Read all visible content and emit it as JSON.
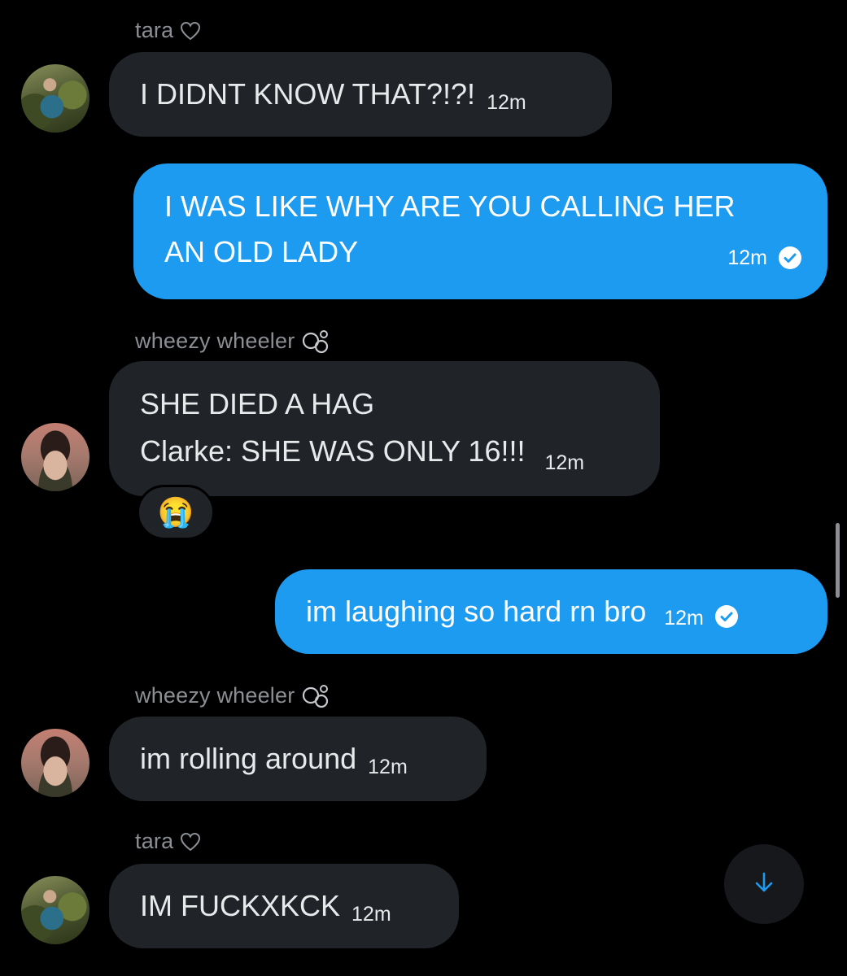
{
  "colors": {
    "background": "#000000",
    "incoming_bubble": "#202327",
    "outgoing_bubble": "#1d9bf0",
    "sender_text": "#8b8f94",
    "accent": "#1d9bf0"
  },
  "messages": [
    {
      "sender": "tara",
      "sender_icon": "heart-outline-icon",
      "avatar": "tara-avatar",
      "text": "I DIDNT KNOW THAT?!?!",
      "time": "12m"
    },
    {
      "direction": "outgoing",
      "lines": [
        "I WAS LIKE WHY ARE YOU CALLING HER",
        "AN OLD LADY"
      ],
      "time": "12m",
      "status": "read-check-icon"
    },
    {
      "sender": "wheezy wheeler",
      "sender_icon": "bubbles-icon",
      "avatar": "wheezy-avatar",
      "lines": [
        "SHE DIED A HAG",
        "Clarke: SHE WAS ONLY 16!!!"
      ],
      "time": "12m",
      "reaction": "😭"
    },
    {
      "direction": "outgoing",
      "text": "im laughing so hard rn bro",
      "time": "12m",
      "status": "read-check-icon"
    },
    {
      "sender": "wheezy wheeler",
      "sender_icon": "bubbles-icon",
      "avatar": "wheezy-avatar",
      "text": "im rolling around",
      "time": "12m"
    },
    {
      "sender": "tara",
      "sender_icon": "heart-outline-icon",
      "avatar": "tara-avatar",
      "text": "IM FUCKXKCK",
      "time": "12m"
    }
  ],
  "scroll_down_icon": "arrow-down-icon"
}
